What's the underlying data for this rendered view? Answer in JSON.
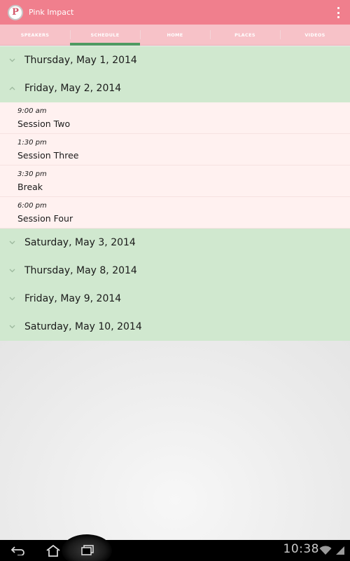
{
  "app": {
    "title": "Pink Impact",
    "logo_letter": "P",
    "colors": {
      "action_bar": "#f07f8d",
      "tab_bar": "#f7c2c8",
      "tab_indicator": "#4f9a62",
      "day_header": "#d0e8cf",
      "session_row": "#fff1f0"
    }
  },
  "tabs": [
    {
      "label": "SPEAKERS",
      "active": false
    },
    {
      "label": "SCHEDULE",
      "active": true
    },
    {
      "label": "HOME",
      "active": false
    },
    {
      "label": "PLACES",
      "active": false
    },
    {
      "label": "VIDEOS",
      "active": false
    }
  ],
  "schedule": {
    "days": [
      {
        "label": "Thursday, May 1, 2014",
        "expanded": false,
        "sessions": []
      },
      {
        "label": "Friday, May 2, 2014",
        "expanded": true,
        "sessions": [
          {
            "time": "9:00 am",
            "name": "Session Two"
          },
          {
            "time": "1:30 pm",
            "name": "Session Three"
          },
          {
            "time": "3:30 pm",
            "name": "Break"
          },
          {
            "time": "6:00 pm",
            "name": "Session Four"
          }
        ]
      },
      {
        "label": "Saturday, May 3, 2014",
        "expanded": false,
        "sessions": []
      },
      {
        "label": "Thursday, May 8, 2014",
        "expanded": false,
        "sessions": []
      },
      {
        "label": "Friday, May 9, 2014",
        "expanded": false,
        "sessions": []
      },
      {
        "label": "Saturday, May 10, 2014",
        "expanded": false,
        "sessions": []
      }
    ]
  },
  "system": {
    "clock": "10:38",
    "icons": [
      "back-icon",
      "home-icon",
      "recent-apps-icon",
      "wifi-icon",
      "signal-icon"
    ]
  }
}
